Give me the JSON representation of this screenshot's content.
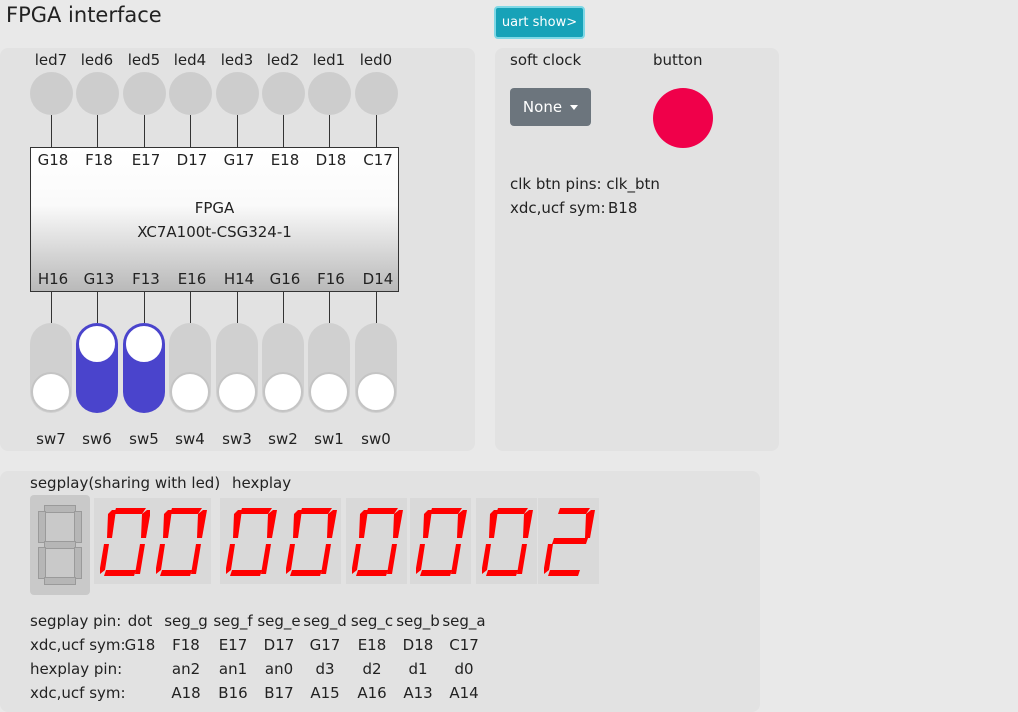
{
  "app": {
    "title": "FPGA interface",
    "uart_button": "uart show>"
  },
  "leds": [
    {
      "label": "led7",
      "pin": "G18"
    },
    {
      "label": "led6",
      "pin": "F18"
    },
    {
      "label": "led5",
      "pin": "E17"
    },
    {
      "label": "led4",
      "pin": "D17"
    },
    {
      "label": "led3",
      "pin": "G17"
    },
    {
      "label": "led2",
      "pin": "E18"
    },
    {
      "label": "led1",
      "pin": "D18"
    },
    {
      "label": "led0",
      "pin": "C17"
    }
  ],
  "fpga": {
    "name": "FPGA",
    "model": "XC7A100t-CSG324-1"
  },
  "switches": [
    {
      "label": "sw7",
      "pin": "H16",
      "on": false
    },
    {
      "label": "sw6",
      "pin": "G13",
      "on": true
    },
    {
      "label": "sw5",
      "pin": "F13",
      "on": true
    },
    {
      "label": "sw4",
      "pin": "E16",
      "on": false
    },
    {
      "label": "sw3",
      "pin": "H14",
      "on": false
    },
    {
      "label": "sw2",
      "pin": "G16",
      "on": false
    },
    {
      "label": "sw1",
      "pin": "F16",
      "on": false
    },
    {
      "label": "sw0",
      "pin": "D14",
      "on": false
    }
  ],
  "clock_panel": {
    "soft_clock_label": "soft clock",
    "button_label": "button",
    "clock_value": "None",
    "clk_btn_pins": "clk btn pins: clk_btn",
    "xdc_label": "xdc,ucf sym:",
    "xdc_value": "B18"
  },
  "segment": {
    "segplay_label": "segplay(sharing with led)",
    "hexplay_label": "hexplay",
    "digits": [
      "0",
      "0",
      "0",
      "0",
      "0",
      "0",
      "0",
      "2"
    ],
    "color_on": "#ff0000"
  },
  "pin_table": {
    "rows": [
      {
        "label": "segplay pin:",
        "cells": [
          "dot",
          "seg_g",
          "seg_f",
          "seg_e",
          "seg_d",
          "seg_c",
          "seg_b",
          "seg_a"
        ]
      },
      {
        "label": "xdc,ucf sym:",
        "cells": [
          "G18",
          "F18",
          "E17",
          "D17",
          "G17",
          "E18",
          "D18",
          "C17"
        ]
      },
      {
        "label": "hexplay pin:",
        "cells": [
          "",
          "an2",
          "an1",
          "an0",
          "d3",
          "d2",
          "d1",
          "d0"
        ]
      },
      {
        "label": "xdc,ucf sym:",
        "cells": [
          "",
          "A18",
          "B16",
          "B17",
          "A15",
          "A16",
          "A13",
          "A14"
        ]
      }
    ]
  }
}
